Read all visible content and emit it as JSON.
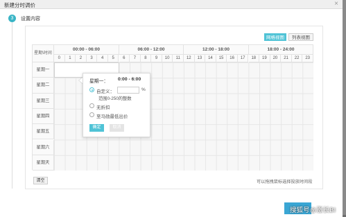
{
  "modal": {
    "title": "新建分时调价",
    "close_symbol": "×"
  },
  "step": {
    "number": "3",
    "title": "设置内容"
  },
  "view_toggle": {
    "grid_label": "网格视图",
    "list_label": "列表视图"
  },
  "schedule": {
    "corner_label": "星期\\时间",
    "ranges": [
      "00:00 - 06:00",
      "06:00 - 12:00",
      "12:00 - 18:00",
      "18:00 - 24:00"
    ],
    "hours": [
      "0",
      "1",
      "2",
      "3",
      "4",
      "5",
      "6",
      "7",
      "8",
      "9",
      "10",
      "11",
      "12",
      "13",
      "14",
      "15",
      "16",
      "17",
      "18",
      "19",
      "20",
      "21",
      "22",
      "23"
    ],
    "days": [
      "星期一",
      "星期二",
      "星期三",
      "星期四",
      "星期五",
      "星期六",
      "星期天"
    ]
  },
  "popover": {
    "day": "星期一：",
    "range": "0:00 - 6:00",
    "option_custom": "自定义：",
    "percent_sign": "%",
    "hint": "范围0-250的整数",
    "option_no_discount": "无折扣",
    "option_lowest_bid": "至马勋最低出价",
    "confirm_label": "确定",
    "cancel_label": "取消",
    "selected_option": "custom"
  },
  "clear_label": "清空",
  "hint_text": "可以拖拽鼠标选择投放时间段",
  "footer": {
    "watermark": "搜狐号@涨长BI"
  },
  "colors": {
    "accent": "#4fc3d6",
    "step": "#3ab5c6",
    "footer_button": "#3aa6d4"
  }
}
